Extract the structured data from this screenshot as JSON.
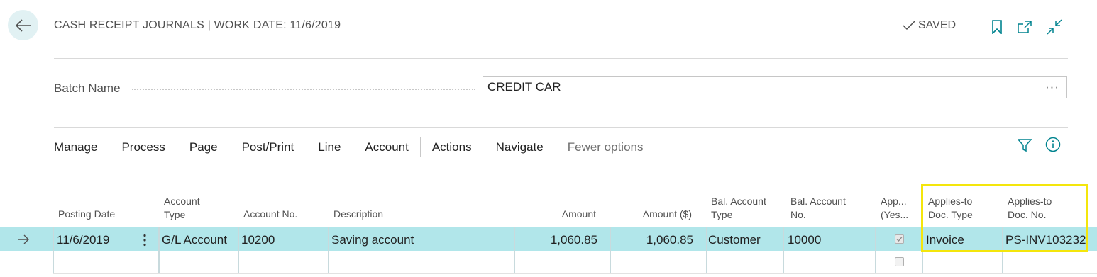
{
  "header": {
    "title": "CASH RECEIPT JOURNALS | WORK DATE: 11/6/2019",
    "status": "SAVED"
  },
  "icons": {
    "back": "back-arrow-icon",
    "saved": "checkmark-icon",
    "bookmark": "bookmark-icon",
    "open_new": "open-in-new-window-icon",
    "collapse": "collapse-icon",
    "filter": "filter-icon",
    "info": "info-icon",
    "row_arrow": "row-arrow-icon",
    "row_menu": "vertical-ellipsis-icon"
  },
  "batch": {
    "label": "Batch Name",
    "value": "CREDIT CAR",
    "lookup": "···"
  },
  "menu": {
    "items": [
      "Manage",
      "Process",
      "Page",
      "Post/Print",
      "Line",
      "Account"
    ],
    "secondary": [
      "Actions",
      "Navigate"
    ],
    "fewer_options": "Fewer options"
  },
  "table": {
    "headers": {
      "posting_date": "Posting Date",
      "account_type_1": "Account",
      "account_type_2": "Type",
      "account_no": "Account No.",
      "description": "Description",
      "amount": "Amount",
      "amount_usd": "Amount ($)",
      "bal_type_1": "Bal. Account",
      "bal_type_2": "Type",
      "bal_no_1": "Bal. Account",
      "bal_no_2": "No.",
      "app_1": "App...",
      "app_2": "(Yes...",
      "applies_type_1": "Applies-to",
      "applies_type_2": "Doc. Type",
      "applies_no_1": "Applies-to",
      "applies_no_2": "Doc. No."
    },
    "rows": [
      {
        "posting_date": "11/6/2019",
        "account_type": "G/L Account",
        "account_no": "10200",
        "description": "Saving account",
        "amount": "1,060.85",
        "amount_usd": "1,060.85",
        "bal_account_type": "Customer",
        "bal_account_no": "10000",
        "applied": true,
        "applies_to_doc_type": "Invoice",
        "applies_to_doc_no": "PS-INV103232"
      }
    ]
  },
  "colors": {
    "accent": "#00838f",
    "selected_row": "#b1e6ea",
    "highlight": "#f4e60c"
  }
}
